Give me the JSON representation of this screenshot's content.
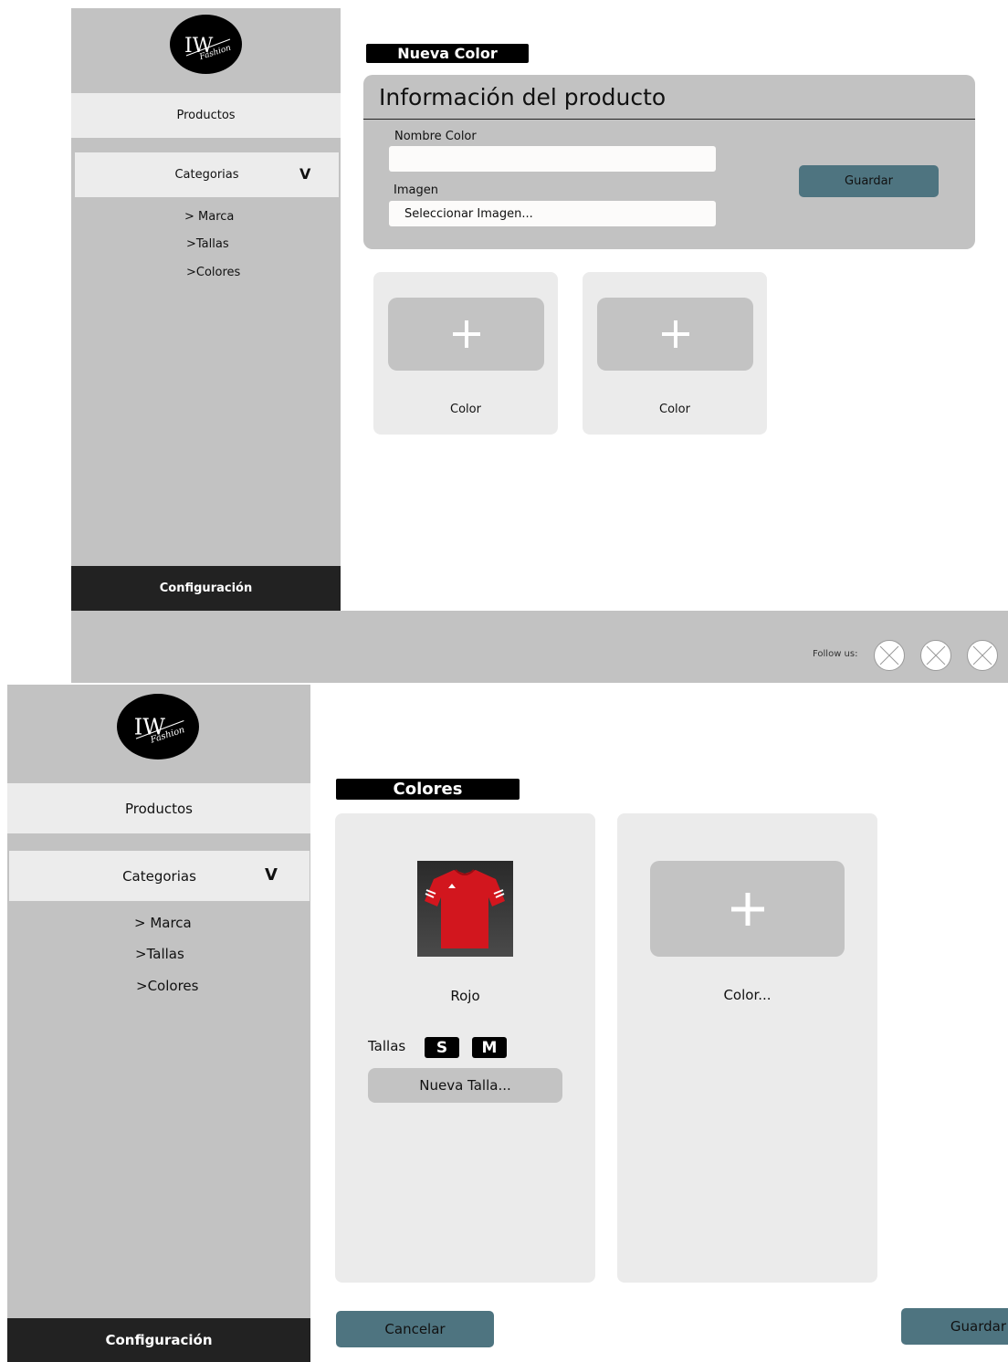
{
  "top": {
    "sidebar": {
      "logo_text": "IW Fashion",
      "productos": "Productos",
      "categorias": "Categorias",
      "chevron": "V",
      "sub_items": [
        "> Marca",
        ">Tallas",
        ">Colores"
      ],
      "config": "Configuración"
    },
    "tag": "Nueva Color",
    "panel_title": "Información del producto",
    "nombre_label": "Nombre Color",
    "nombre_value": "",
    "imagen_label": "Imagen",
    "imagen_value": "Seleccionar Imagen...",
    "guardar": "Guardar",
    "cards": [
      {
        "label": "Color",
        "icon": "plus-icon"
      },
      {
        "label": "Color",
        "icon": "plus-icon"
      }
    ],
    "footer": {
      "follow": "Follow us:",
      "social_icons": [
        "social-icon-1",
        "social-icon-2",
        "social-icon-3"
      ]
    }
  },
  "bottom": {
    "sidebar": {
      "logo_text": "IW Fashion",
      "productos": "Productos",
      "categorias": "Categorias",
      "chevron": "V",
      "sub_items": [
        "> Marca",
        ">Tallas",
        ">Colores"
      ],
      "config": "Configuración"
    },
    "tag": "Colores",
    "color_card": {
      "name": "Rojo",
      "tallas_label": "Tallas",
      "sizes": [
        "S",
        "M"
      ],
      "nueva_talla": "Nueva Talla..."
    },
    "add_card": {
      "label": "Color...",
      "icon": "plus-icon"
    },
    "cancelar": "Cancelar",
    "guardar": "Guardar"
  },
  "colors": {
    "sidebar": "#c2c2c2",
    "menu_item": "#ececec",
    "config_bg": "#222222",
    "teal": "#4e7480",
    "card": "#ebebeb",
    "plus_box": "#c3c3c3",
    "jersey_red": "#d2161e"
  }
}
